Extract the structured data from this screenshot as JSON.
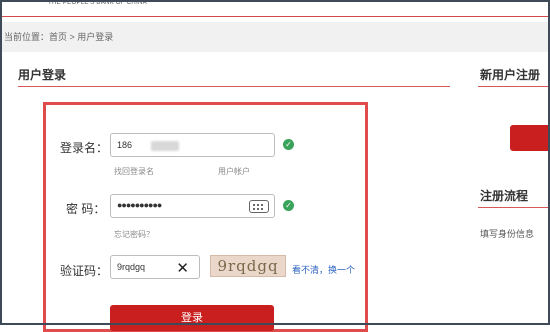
{
  "header": {
    "bank_name_en": "THE PEOPLE'S BANK OF CHINA"
  },
  "breadcrumb": {
    "text": "当前位置：首页 > 用户登录"
  },
  "login": {
    "title": "用户登录",
    "username_label": "登录名：",
    "username_value": "186",
    "username_hints": [
      "找回登录名",
      "用户帐户"
    ],
    "password_label": "密  码：",
    "password_value": "●●●●●●●●●●",
    "password_hint": "忘记密码？",
    "captcha_label": "验证码：",
    "captcha_value": "9rqdgq",
    "captcha_image_text": "9rqdgq",
    "refresh_link": "看不清，换一个",
    "login_button": "登录"
  },
  "register": {
    "title": "新用户注册"
  },
  "flow": {
    "title": "注册流程",
    "text": "填写身份信息"
  },
  "colors": {
    "accent": "#c91f1f",
    "box_border": "#e04b4b",
    "ok_green": "#3aa35b"
  },
  "icons": {
    "ok": "check-circle-icon",
    "keyboard": "keyboard-icon",
    "clear": "close-icon"
  }
}
